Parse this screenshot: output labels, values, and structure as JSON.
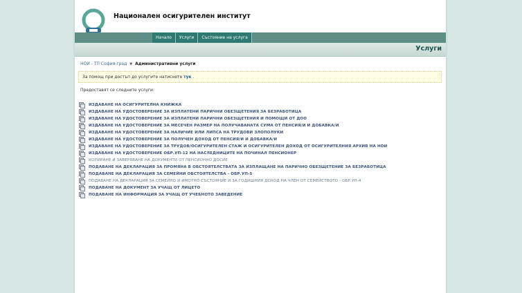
{
  "header": {
    "site_title": "Национален осигурителен институт"
  },
  "nav": [
    "Начало",
    "Услуги",
    "Състояние на услуга"
  ],
  "section": {
    "title": "Услуги"
  },
  "breadcrumb": {
    "home": "НОИ - ТП София-град",
    "current": "Административни услуги"
  },
  "notice": {
    "text": "За помощ при достъп до услугите натиснете",
    "link": "тук",
    "tail": "."
  },
  "intro": "Предоставят се следните услуги:",
  "services": [
    "Издаване на осигурителна книжка",
    "Издаване на удостоверение за изплатени парични обезщетения за безработица",
    "Издаване на удостоверение за изплатени парични обезщетения и помощи от ДОО",
    "Издаване на удостоверение за месечен размер на получаваната сума от пенсия/и и добавка/и",
    "Издаване на удостоверение за наличие или липса на трудови злополуки",
    "Издаване на удостоверение за получен доход от пенсия/и и добавка/и",
    "Издаване на удостоверение за трудов/осигурителен стаж и осигурителен доход от осигурителния архив на НОИ",
    "Издаване на удостоверение обр.УП-12 на наследниците на починал пенсионер",
    "Копиране и заверяване на документи от пенсионно досие",
    "Подаване на декларация за промяна в обстоятелствата за изплащане на парично обезщетение за безработица",
    "Подаване на декларация за семейни обстоятелства - обр.УП-5",
    "Подаване на декларация за семейно и имотно състояние и за годишния доход на член от семейството - обр.УП-4",
    "Подаване на документ за учащ от лицето",
    "Подаване на информация за учащ от учебното заведение"
  ],
  "colors": {
    "accent": "#2e7a72",
    "link": "#3d4f7a",
    "background": "#d6e6e2"
  }
}
